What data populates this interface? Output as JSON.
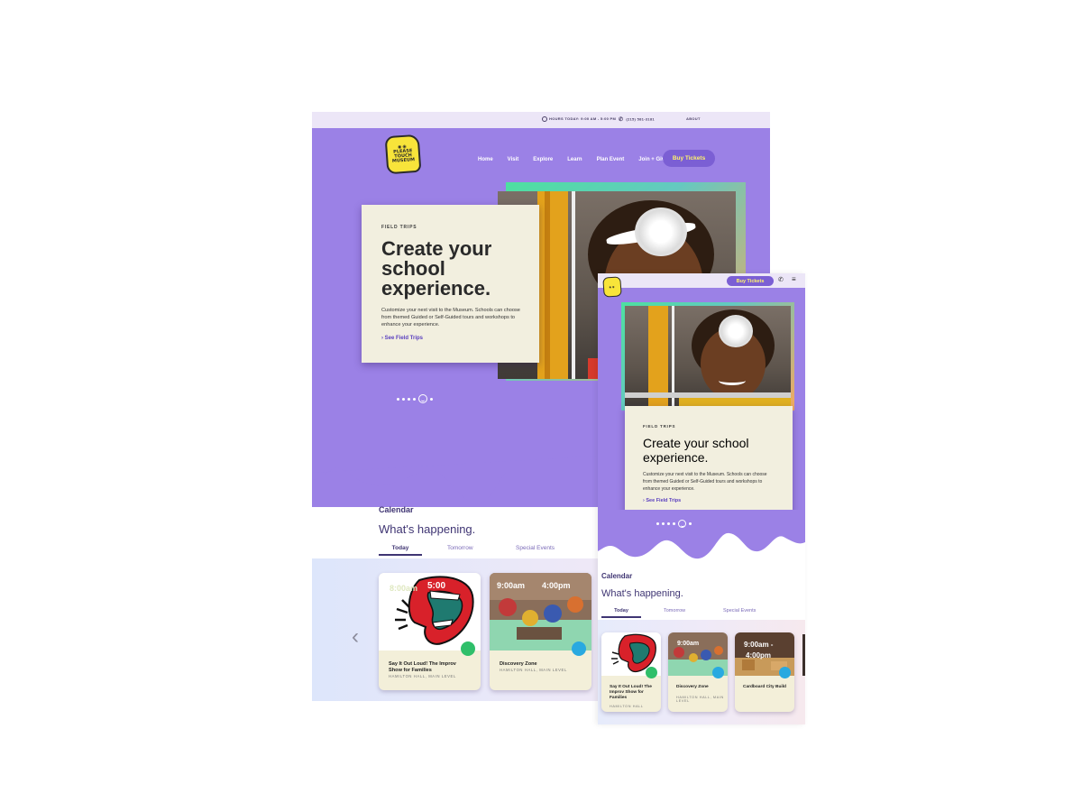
{
  "desktop": {
    "topbar": {
      "hours": "HOURS TODAY: 9:00 am - 5:00 pm",
      "phone": "(215) 581-3181",
      "about": "ABOUT"
    },
    "logo": {
      "line1": "PLEASE",
      "line2": "TOUCH",
      "line3": "MUSEUM"
    },
    "nav": [
      {
        "label": "Home"
      },
      {
        "label": "Visit"
      },
      {
        "label": "Explore"
      },
      {
        "label": "Learn"
      },
      {
        "label": "Plan Event"
      },
      {
        "label": "Join + Give"
      }
    ],
    "buy_label": "Buy Tickets",
    "hero": {
      "kicker": "FIELD TRIPS",
      "title": "Create your school experience.",
      "body": "Customize your next visit to the Museum. Schools can choose from themed Guided or Self-Guided tours and workshops to enhance your experience.",
      "link": "See Field Trips"
    },
    "calendar": {
      "label": "Calendar",
      "heading": "What's happening.",
      "tabs": [
        "Today",
        "Tomorrow",
        "Special Events"
      ],
      "events": [
        {
          "name": "Say It Out Loud! The Improv Show for Families",
          "location": "HAMILTON HALL, MAIN LEVEL",
          "time_a": "8:00am",
          "time_b": "5:00"
        },
        {
          "name": "Discovery Zone",
          "location": "HAMILTON HALL, MAIN LEVEL",
          "time_a": "9:00am",
          "time_b": "4:00pm"
        }
      ]
    }
  },
  "mobile": {
    "buy_label": "Buy Tickets",
    "hero": {
      "kicker": "FIELD TRIPS",
      "title": "Create your school experience.",
      "body": "Customize your next visit to the Museum. Schools can choose from themed Guided or Self-Guided tours and workshops to enhance your experience.",
      "link": "See Field Trips"
    },
    "calendar": {
      "label": "Calendar",
      "heading": "What's happening.",
      "tabs": [
        "Today",
        "Tomorrow",
        "Special Events"
      ],
      "events": [
        {
          "name": "Say It Out Loud! The Improv Show for Families",
          "location": "HAMILTON HALL"
        },
        {
          "name": "Discovery Zone",
          "location": "HAMILTON HALL, MAIN LEVEL",
          "time": "9:00am"
        },
        {
          "name": "Cardboard City Build",
          "time_a": "9:00am -",
          "time_b": "4:00pm"
        }
      ]
    }
  },
  "colors": {
    "hero_purple": "#9b81e6",
    "button_purple": "#7b5fd4",
    "button_text_yellow": "#fff36b",
    "card_cream": "#f2efdf",
    "heading_indigo": "#3f3573",
    "logo_yellow": "#f8e43a",
    "badge_green": "#2fbf6a",
    "badge_blue": "#29a9e0"
  },
  "icons": [
    "clock-icon",
    "phone-icon",
    "chevron-right-icon",
    "chevron-left-icon",
    "smiley-dot-icon",
    "menu-icon",
    "theater-masks-icon",
    "cube-icon"
  ]
}
